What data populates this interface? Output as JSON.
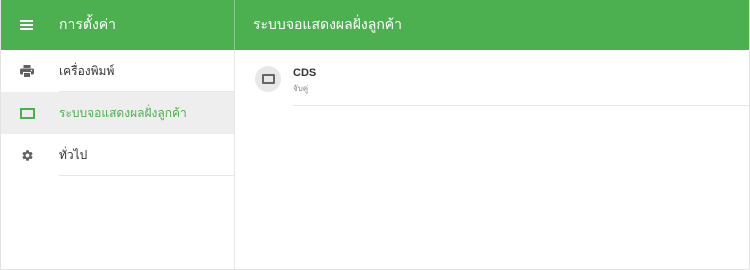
{
  "header": {
    "app_title": "การตั้งค่า",
    "page_title": "ระบบจอแสดงผลฝั่งลูกค้า",
    "menu_icon": "menu-icon",
    "background_color": "#4caf50"
  },
  "sidebar": {
    "items": [
      {
        "label": "เครื่องพิมพ์",
        "icon": "printer-icon",
        "active": false
      },
      {
        "label": "ระบบจอแสดงผลฝั่งลูกค้า",
        "icon": "display-icon",
        "active": true
      },
      {
        "label": "ทั่วไป",
        "icon": "gear-icon",
        "active": false
      }
    ],
    "active_color": "#4caf50"
  },
  "devices": [
    {
      "name": "CDS",
      "status": "จับคู่",
      "icon": "display-icon"
    }
  ]
}
